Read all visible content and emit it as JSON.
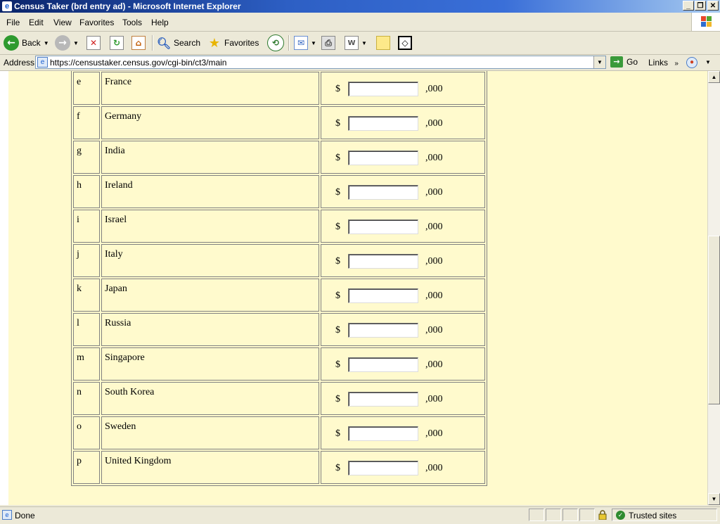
{
  "window": {
    "title": "Census Taker (brd entry ad) - Microsoft Internet Explorer",
    "minimize": "_",
    "restore": "❐",
    "close": "✕"
  },
  "menu": {
    "items": [
      "File",
      "Edit",
      "View",
      "Favorites",
      "Tools",
      "Help"
    ]
  },
  "toolbar": {
    "back_label": "Back",
    "search_label": "Search",
    "favorites_label": "Favorites"
  },
  "address": {
    "label": "Address",
    "url": "https://censustaker.census.gov/cgi-bin/ct3/main",
    "go_label": "Go",
    "links_label": "Links"
  },
  "table": {
    "currency": "$",
    "suffix": ",000",
    "rows": [
      {
        "letter": "e",
        "country": "France",
        "value": ""
      },
      {
        "letter": "f",
        "country": "Germany",
        "value": ""
      },
      {
        "letter": "g",
        "country": "India",
        "value": ""
      },
      {
        "letter": "h",
        "country": "Ireland",
        "value": ""
      },
      {
        "letter": "i",
        "country": "Israel",
        "value": ""
      },
      {
        "letter": "j",
        "country": "Italy",
        "value": ""
      },
      {
        "letter": "k",
        "country": "Japan",
        "value": ""
      },
      {
        "letter": "l",
        "country": "Russia",
        "value": ""
      },
      {
        "letter": "m",
        "country": "Singapore",
        "value": ""
      },
      {
        "letter": "n",
        "country": "South Korea",
        "value": ""
      },
      {
        "letter": "o",
        "country": "Sweden",
        "value": ""
      },
      {
        "letter": "p",
        "country": "United Kingdom",
        "value": ""
      }
    ]
  },
  "status": {
    "text": "Done",
    "zone": "Trusted sites"
  },
  "colors": {
    "page_background": "#fffacd",
    "title_bar": "#0a246a"
  }
}
